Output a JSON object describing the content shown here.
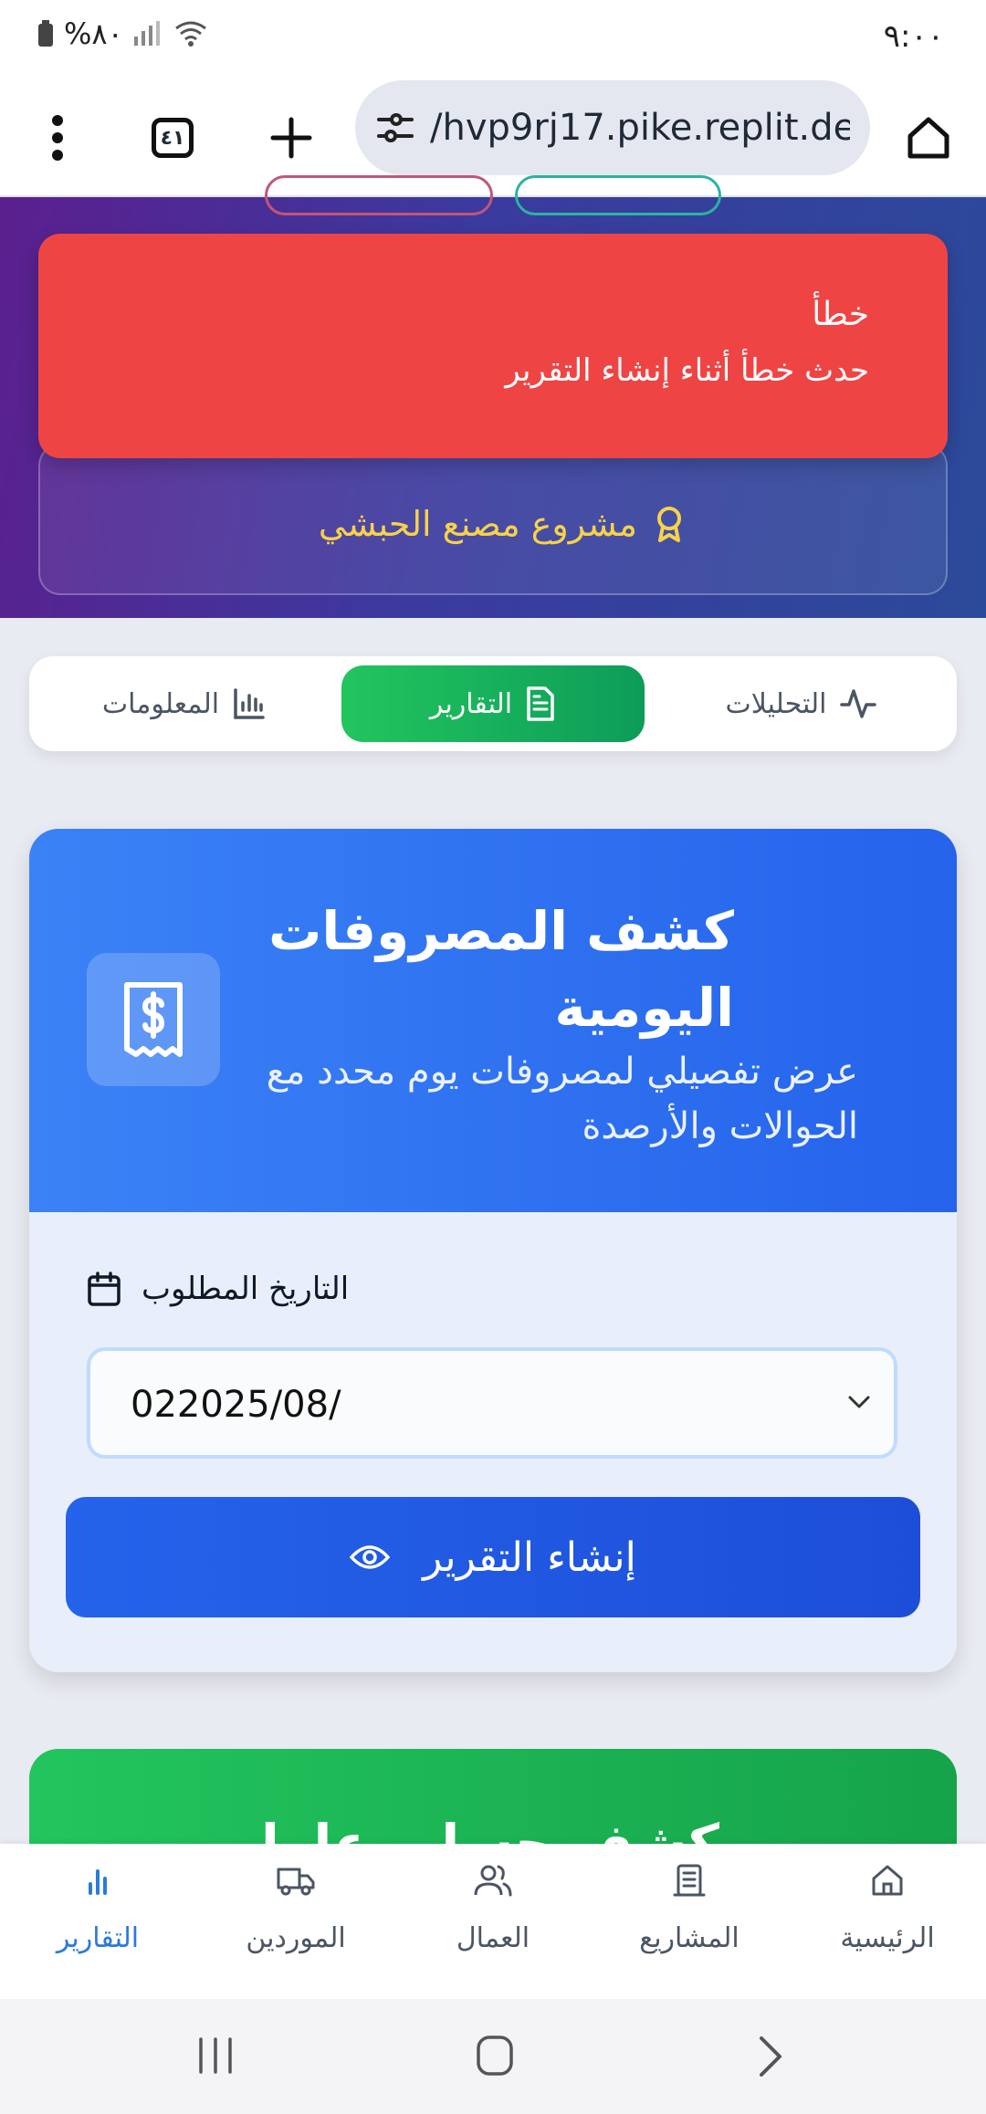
{
  "status_bar": {
    "time": "٩:٠٠",
    "battery": "%٨٠"
  },
  "browser": {
    "url": "/hvp9rj17.pike.replit.dev",
    "tab_count": "٤١"
  },
  "toast": {
    "title": "خطأ",
    "message": "حدث خطأ أثناء إنشاء التقرير"
  },
  "project": {
    "name": "مشروع مصنع الحبشي"
  },
  "segments": [
    {
      "label": "التحليلات",
      "icon": "activity-icon"
    },
    {
      "label": "التقارير",
      "icon": "file-text-icon",
      "active": true
    },
    {
      "label": "المعلومات",
      "icon": "bar-chart-icon"
    }
  ],
  "report_card": {
    "title": "كشف المصروفات اليومية",
    "subtitle": "عرض تفصيلي لمصروفات يوم محدد مع الحوالات والأرصدة",
    "date_label": "التاريخ المطلوب",
    "date_value": "022025/08/",
    "button_label": "إنشاء التقرير",
    "icon": "receipt-dollar-icon"
  },
  "next_card": {
    "title_partial": "كشف حساب عامل"
  },
  "bottom_nav": [
    {
      "label": "الرئيسية",
      "icon": "home-icon"
    },
    {
      "label": "المشاريع",
      "icon": "building-icon"
    },
    {
      "label": "العمال",
      "icon": "users-icon"
    },
    {
      "label": "الموردين",
      "icon": "truck-icon"
    },
    {
      "label": "التقارير",
      "icon": "bar-chart-icon",
      "active": true
    }
  ],
  "colors": {
    "error": "#ef4444",
    "primary_blue": "#2563eb",
    "green": "#22c55e",
    "project_gold": "#f7d24a",
    "nav_active": "#2b7bd8"
  }
}
